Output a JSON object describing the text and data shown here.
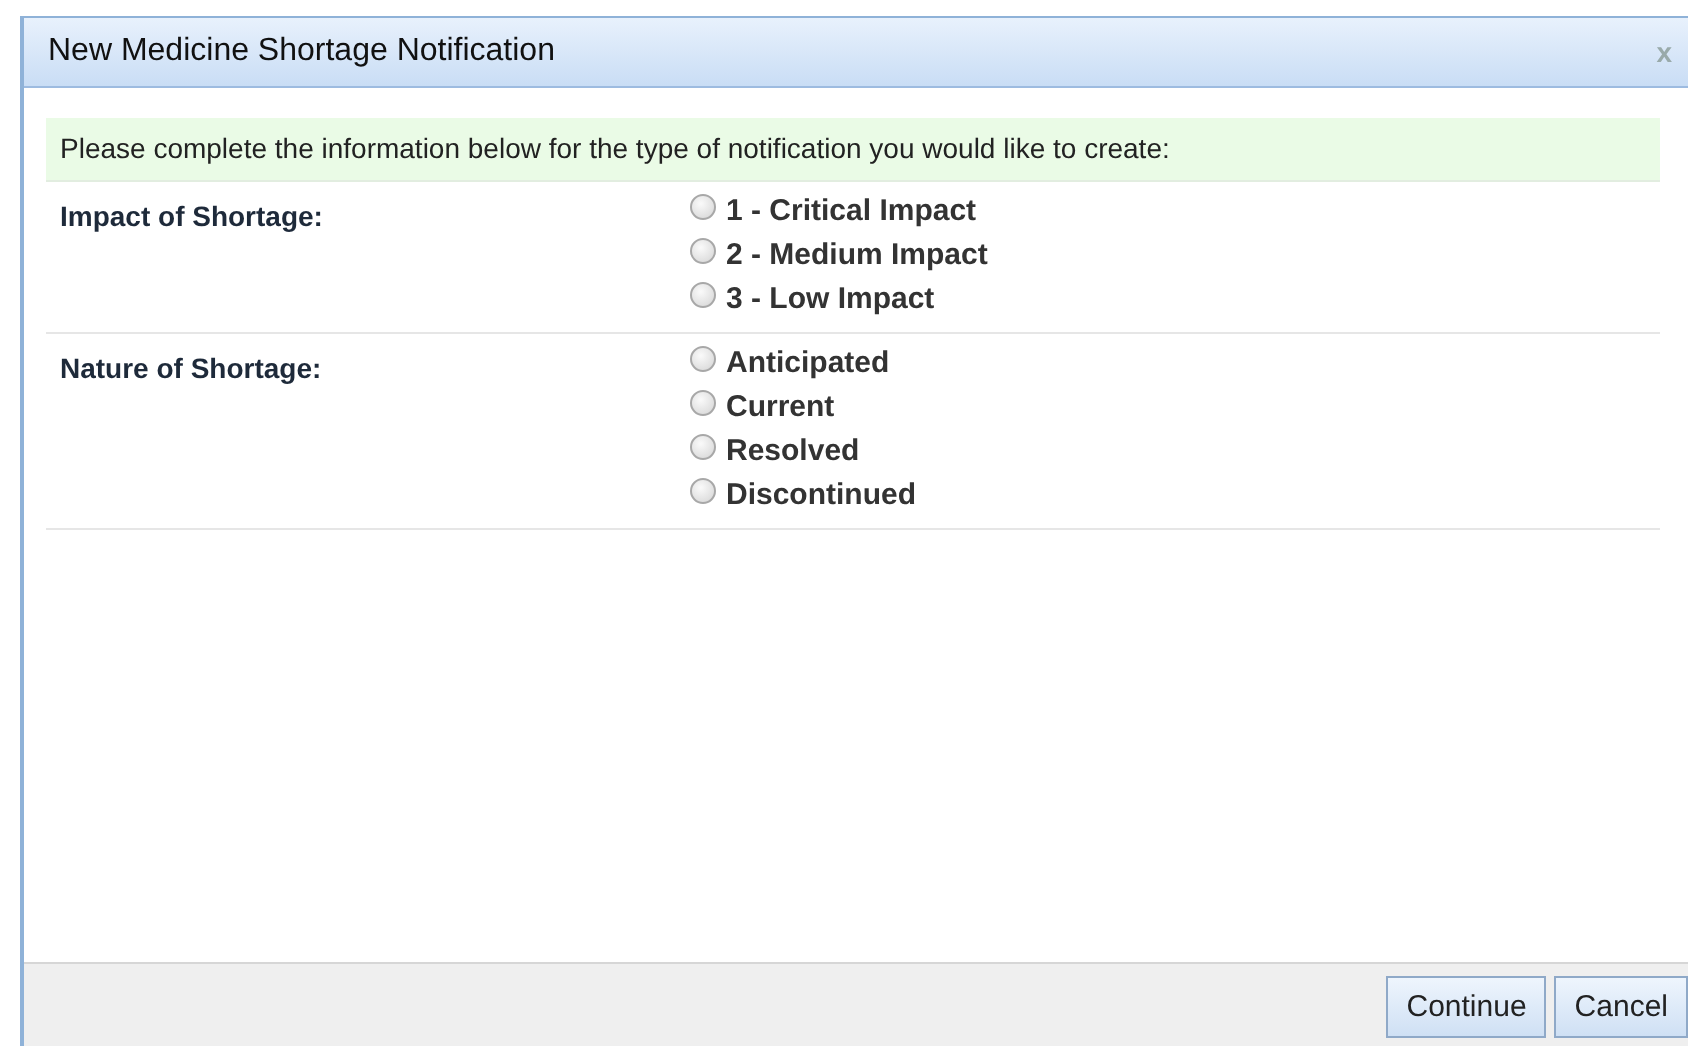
{
  "window": {
    "title": "New Medicine Shortage Notification",
    "close": "x"
  },
  "instruction": "Please complete the information below for the type of notification you would like to create:",
  "sections": [
    {
      "label": "Impact of Shortage:",
      "options": [
        {
          "label": "1 - Critical Impact",
          "selected": false
        },
        {
          "label": "2 - Medium Impact",
          "selected": false
        },
        {
          "label": "3 - Low Impact",
          "selected": false
        }
      ]
    },
    {
      "label": "Nature of Shortage:",
      "options": [
        {
          "label": "Anticipated",
          "selected": false
        },
        {
          "label": "Current",
          "selected": false
        },
        {
          "label": "Resolved",
          "selected": false
        },
        {
          "label": "Discontinued",
          "selected": false
        }
      ]
    }
  ],
  "buttons": [
    "Continue",
    "Cancel"
  ]
}
